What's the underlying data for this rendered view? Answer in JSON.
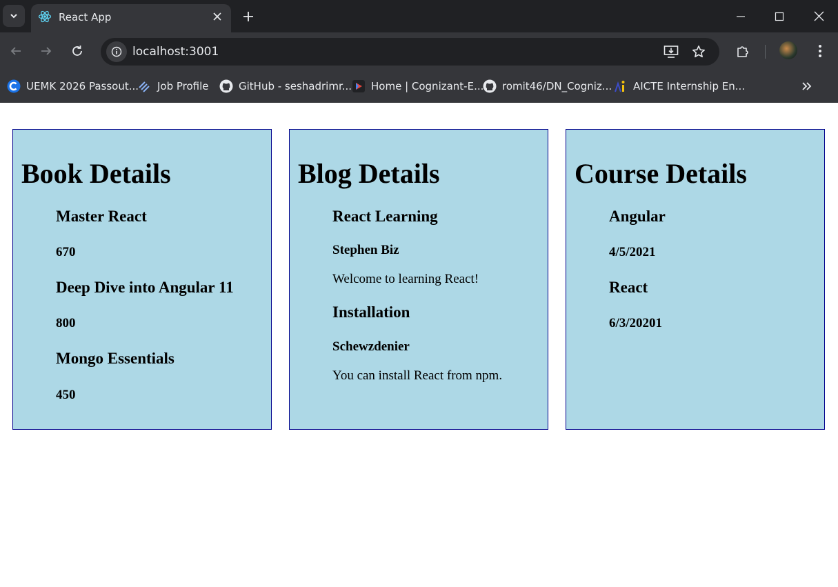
{
  "browser": {
    "tab_title": "React App",
    "url": "localhost:3001",
    "bookmarks": [
      {
        "label": "UEMK 2026 Passout...",
        "icon": "c-logo-icon"
      },
      {
        "label": "Job Profile",
        "icon": "stripes-logo-icon"
      },
      {
        "label": "GitHub - seshadrimr...",
        "icon": "github-icon"
      },
      {
        "label": "Home | Cognizant-E...",
        "icon": "play-logo-icon"
      },
      {
        "label": "romit46/DN_Cogniz...",
        "icon": "github-icon"
      },
      {
        "label": "AICTE Internship En...",
        "icon": "aicte-logo-icon"
      }
    ]
  },
  "page": {
    "book": {
      "title": "Book Details",
      "items": [
        {
          "name": "Master React",
          "price": "670"
        },
        {
          "name": "Deep Dive into Angular 11",
          "price": "800"
        },
        {
          "name": "Mongo Essentials",
          "price": "450"
        }
      ]
    },
    "blog": {
      "title": "Blog Details",
      "items": [
        {
          "title": "React Learning",
          "author": "Stephen Biz",
          "content": "Welcome to learning React!"
        },
        {
          "title": "Installation",
          "author": "Schewzdenier",
          "content": "You can install React from npm."
        }
      ]
    },
    "course": {
      "title": "Course Details",
      "items": [
        {
          "name": "Angular",
          "date": "4/5/2021"
        },
        {
          "name": "React",
          "date": "6/3/20201"
        }
      ]
    }
  },
  "colors": {
    "card_background": "#add8e6",
    "card_border": "#00008b",
    "chrome_dark": "#202124",
    "chrome_toolbar": "#35363a"
  }
}
